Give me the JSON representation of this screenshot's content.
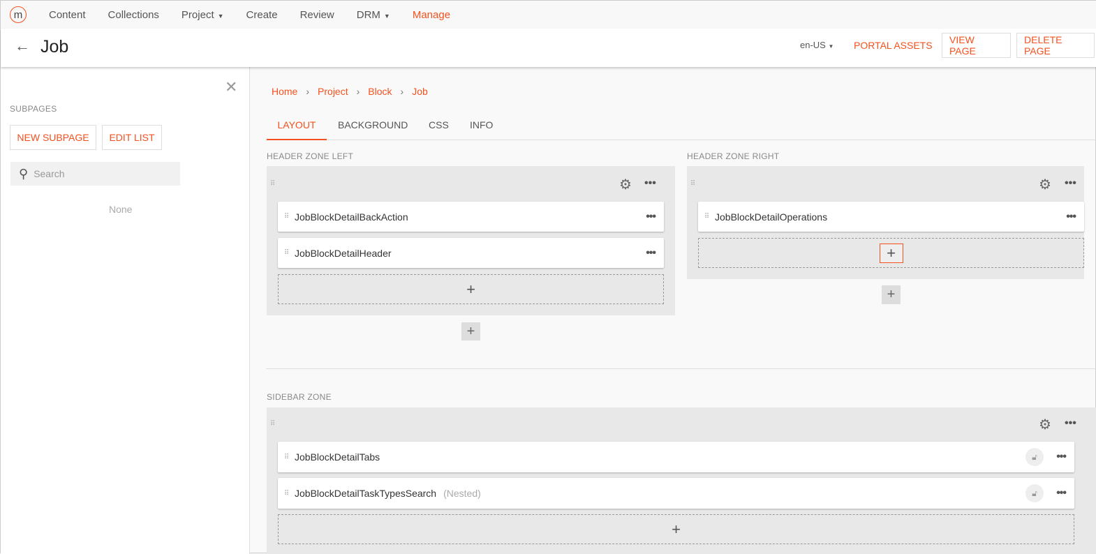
{
  "nav": {
    "logo": "m",
    "items": [
      "Content",
      "Collections",
      "Project",
      "Create",
      "Review",
      "DRM",
      "Manage"
    ]
  },
  "header": {
    "title": "Job",
    "lang": "en-US",
    "portal_assets": "PORTAL ASSETS",
    "view_page": "VIEW PAGE",
    "delete_page": "DELETE PAGE"
  },
  "left": {
    "section": "SUBPAGES",
    "new_subpage": "NEW SUBPAGE",
    "edit_list": "EDIT LIST",
    "search_placeholder": "Search",
    "empty": "None"
  },
  "breadcrumb": [
    "Home",
    "Project",
    "Block",
    "Job"
  ],
  "tabs": [
    "LAYOUT",
    "BACKGROUND",
    "CSS",
    "INFO"
  ],
  "zones": {
    "header_left": {
      "label": "HEADER ZONE LEFT",
      "items": [
        "JobBlockDetailBackAction",
        "JobBlockDetailHeader"
      ]
    },
    "header_right": {
      "label": "HEADER ZONE RIGHT",
      "items": [
        "JobBlockDetailOperations"
      ]
    },
    "sidebar": {
      "label": "SIDEBAR ZONE",
      "items": [
        "JobBlockDetailTabs",
        "JobBlockDetailTaskTypesSearch"
      ],
      "nested_tag": "(Nested)"
    }
  },
  "colors": {
    "accent": "#f4511e"
  }
}
